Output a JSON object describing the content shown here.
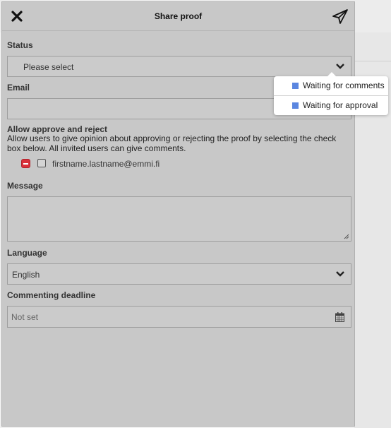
{
  "dialog": {
    "title": "Share proof"
  },
  "status": {
    "label": "Status",
    "value": "Please select",
    "options": [
      "Waiting for comments",
      "Waiting for approval"
    ],
    "option_color": "#5b86e0"
  },
  "email": {
    "label": "Email",
    "value": ""
  },
  "approve": {
    "label": "Allow approve and reject",
    "help": "Allow users to give opinion about approving or rejecting the proof by selecting the check box below. All invited users can give comments.",
    "users": [
      {
        "email": "firstname.lastname@emmi.fi",
        "checked": false
      }
    ]
  },
  "message": {
    "label": "Message",
    "value": ""
  },
  "language": {
    "label": "Language",
    "value": "English"
  },
  "deadline": {
    "label": "Commenting deadline",
    "value": "Not set"
  },
  "icons": {
    "close": "close-icon",
    "send": "paper-plane-icon",
    "dropdown": "chevron-down-icon",
    "calendar": "calendar-icon",
    "remove": "remove-user-icon"
  }
}
